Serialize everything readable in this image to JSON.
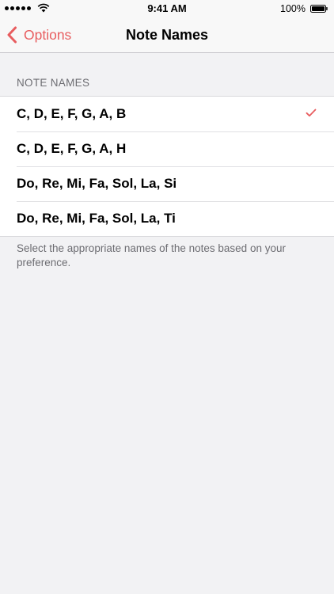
{
  "status_bar": {
    "time": "9:41 AM",
    "battery": "100%",
    "signal_icon": "signal-dots-icon",
    "wifi_icon": "wifi-icon",
    "battery_icon": "battery-icon"
  },
  "nav": {
    "back_label": "Options",
    "title": "Note Names",
    "accent_color": "#e85d5f"
  },
  "section": {
    "header": "NOTE NAMES",
    "items": [
      {
        "label": "C, D, E, F, G, A, B",
        "selected": true
      },
      {
        "label": "C, D, E, F, G, A, H",
        "selected": false
      },
      {
        "label": "Do, Re, Mi, Fa, Sol, La, Si",
        "selected": false
      },
      {
        "label": "Do, Re, Mi, Fa, Sol, La, Ti",
        "selected": false
      }
    ],
    "footer": "Select the appropriate names of the notes based on your preference."
  }
}
